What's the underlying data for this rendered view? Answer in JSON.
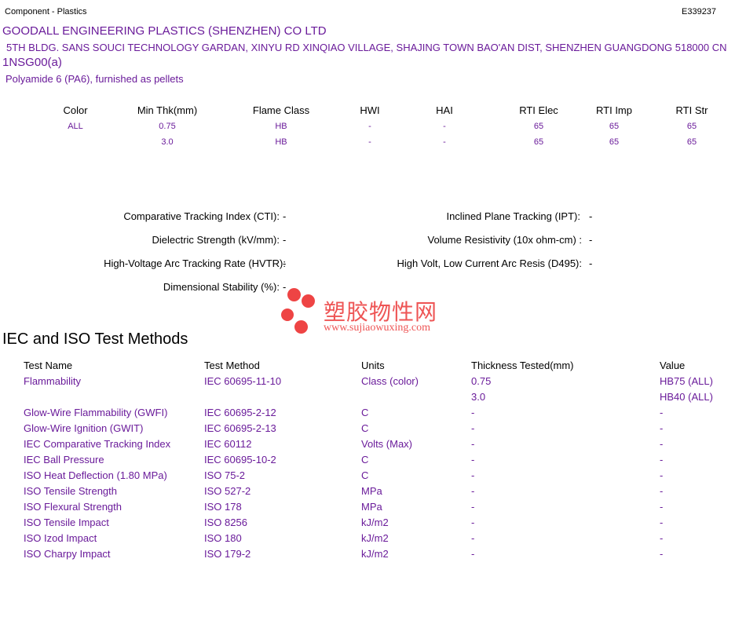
{
  "header": {
    "category": "Component - Plastics",
    "file_no": "E339237",
    "company": "GOODALL ENGINEERING PLASTICS (SHENZHEN) CO LTD",
    "address": "5TH BLDG. SANS SOUCI TECHNOLOGY GARDAN, XINYU RD XINQIAO VILLAGE, SHAJING TOWN BAO'AN DIST, SHENZHEN  GUANGDONG  518000 CN",
    "grade": "1NSG00(a)",
    "description": "Polyamide 6 (PA6), furnished as pellets"
  },
  "ratings": {
    "headers": [
      "Color",
      "Min Thk(mm)",
      "Flame Class",
      "HWI",
      "HAI",
      "RTI Elec",
      "RTI Imp",
      "RTI Str"
    ],
    "rows": [
      [
        "ALL",
        "0.75",
        "HB",
        "-",
        "-",
        "65",
        "65",
        "65"
      ],
      [
        "",
        "3.0",
        "HB",
        "-",
        "-",
        "65",
        "65",
        "65"
      ]
    ]
  },
  "properties": {
    "left": [
      {
        "label": "Comparative Tracking Index (CTI):",
        "value": "-"
      },
      {
        "label": "Dielectric Strength (kV/mm):",
        "value": "-"
      },
      {
        "label": "High-Voltage Arc Tracking Rate (HVTR):",
        "value": "-"
      },
      {
        "label": "Dimensional Stability (%):",
        "value": "-"
      }
    ],
    "right": [
      {
        "label": "Inclined Plane Tracking (IPT):",
        "value": "-"
      },
      {
        "label": "Volume Resistivity (10x ohm-cm) :",
        "value": "-"
      },
      {
        "label": "High Volt, Low Current Arc Resis (D495):",
        "value": "-"
      }
    ]
  },
  "watermark": {
    "cn": "塑胶物性网",
    "url": "www.sujiaowuxing.com"
  },
  "tests": {
    "title": "IEC and ISO Test Methods",
    "headers": [
      "Test Name",
      "Test Method",
      "Units",
      "Thickness Tested(mm)",
      "Value"
    ],
    "rows": [
      [
        "Flammability",
        "IEC 60695-11-10",
        "Class (color)",
        "0.75",
        "HB75 (ALL)"
      ],
      [
        "",
        "",
        "",
        "3.0",
        "HB40 (ALL)"
      ],
      [
        "Glow-Wire Flammability (GWFI)",
        "IEC 60695-2-12",
        "C",
        "-",
        "-"
      ],
      [
        "Glow-Wire Ignition (GWIT)",
        "IEC 60695-2-13",
        "C",
        "-",
        "-"
      ],
      [
        "IEC Comparative Tracking Index",
        "IEC 60112",
        "Volts (Max)",
        "-",
        "-"
      ],
      [
        "IEC Ball Pressure",
        "IEC 60695-10-2",
        "C",
        "-",
        "-"
      ],
      [
        "ISO Heat Deflection (1.80 MPa)",
        "ISO 75-2",
        "C",
        "-",
        "-"
      ],
      [
        "ISO Tensile Strength",
        "ISO 527-2",
        "MPa",
        "-",
        "-"
      ],
      [
        "ISO Flexural Strength",
        "ISO 178",
        "MPa",
        "-",
        "-"
      ],
      [
        "ISO Tensile Impact",
        "ISO 8256",
        "kJ/m2",
        "-",
        "-"
      ],
      [
        "ISO Izod Impact",
        "ISO 180",
        "kJ/m2",
        "-",
        "-"
      ],
      [
        "ISO Charpy Impact",
        "ISO 179-2",
        "kJ/m2",
        "-",
        "-"
      ]
    ]
  }
}
